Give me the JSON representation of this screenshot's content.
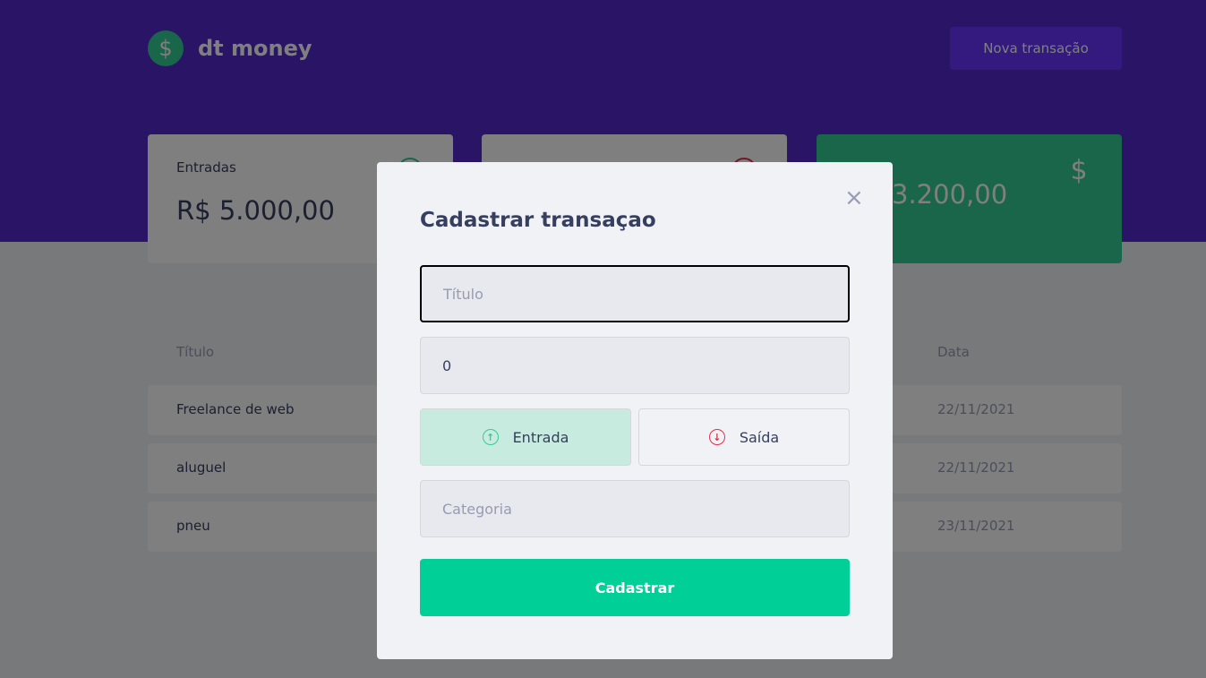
{
  "header": {
    "logo_symbol": "$",
    "app_name": "dt money",
    "new_transaction_label": "Nova transação"
  },
  "summary": {
    "income": {
      "label": "Entradas",
      "value": "R$ 5.000,00",
      "icon": "arrow-up-circle-icon"
    },
    "outcome": {
      "label": "",
      "value": "",
      "icon": "arrow-down-circle-icon"
    },
    "total": {
      "label": "",
      "value": "3.200,00",
      "icon": "dollar-icon"
    }
  },
  "table": {
    "headers": {
      "title": "Título",
      "date": "Data"
    },
    "rows": [
      {
        "title": "Freelance de web",
        "date": "22/11/2021"
      },
      {
        "title": "aluguel",
        "date": "22/11/2021"
      },
      {
        "title": "pneu",
        "date": "23/11/2021"
      }
    ]
  },
  "modal": {
    "title": "Cadastrar transaçao",
    "close_symbol": "×",
    "title_placeholder": "Título",
    "amount_value": "0",
    "deposit_label": "Entrada",
    "withdraw_label": "Saída",
    "category_placeholder": "Categoria",
    "submit_label": "Cadastrar"
  },
  "colors": {
    "header_bg": "#5429cc",
    "income_green": "#33cc95",
    "outcome_red": "#e52e4d",
    "submit_green": "#00cf97"
  }
}
